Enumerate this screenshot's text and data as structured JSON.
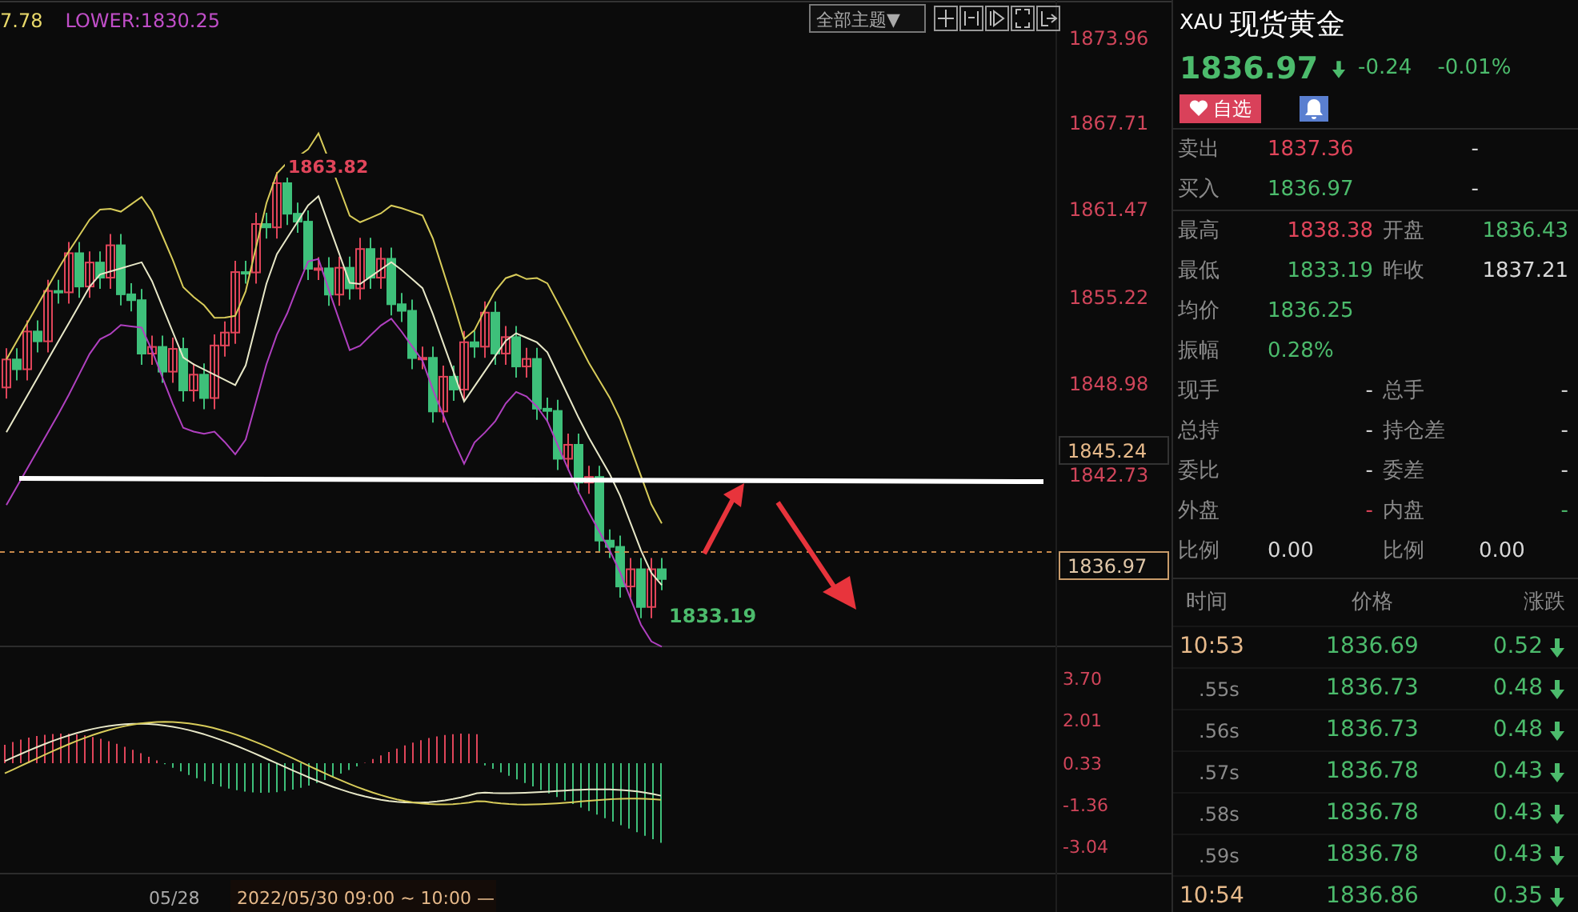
{
  "chart": {
    "indicators": [
      {
        "text": "7.78",
        "color": "#e8d86a"
      },
      {
        "text": "LOWER:1830.25",
        "color": "#c04ec8"
      }
    ],
    "theme_dropdown": "全部主题▼",
    "toolbar_buttons": [
      {
        "kind": "crosshair"
      },
      {
        "kind": "zoom-in"
      },
      {
        "kind": "play"
      },
      {
        "kind": "fullscreen"
      },
      {
        "kind": "exit"
      }
    ],
    "price_axis": [
      "1873.96",
      "1867.71",
      "1861.47",
      "1855.22",
      "1848.98",
      "1842.73"
    ],
    "price_tags": [
      {
        "text": "1845.24",
        "kind": "level"
      },
      {
        "text": "1836.97",
        "kind": "current"
      }
    ],
    "high_label": "1863.82",
    "low_label": "1833.19",
    "macd_axis": [
      "3.70",
      "2.01",
      "0.33",
      "-1.36",
      "-3.04"
    ],
    "time_axis": [
      {
        "text": "05/28",
        "kind": "date"
      },
      {
        "text": "2022/05/30 09:00 ~ 10:00 —",
        "kind": "cursor"
      }
    ]
  },
  "quote": {
    "symbol": "XAU",
    "name": "现货黄金",
    "price": "1836.97",
    "falling": true,
    "change": "-0.24",
    "change_pct": "-0.01%",
    "watch_button": "自选",
    "alert_button": {
      "kind": "bell"
    }
  },
  "order_rows": [
    {
      "label": "卖出",
      "value": "1837.36",
      "color": "#e0455a",
      "extra": "-"
    },
    {
      "label": "买入",
      "value": "1836.97",
      "color": "#4cbb6c",
      "extra": "-"
    }
  ],
  "stats": [
    {
      "cells": [
        {
          "label": "最高",
          "value": "1838.38",
          "color": "#e0455a"
        },
        {
          "label": "开盘",
          "value": "1836.43",
          "color": "#4cbb6c"
        }
      ]
    },
    {
      "cells": [
        {
          "label": "最低",
          "value": "1833.19",
          "color": "#4cbb6c"
        },
        {
          "label": "昨收",
          "value": "1837.21",
          "color": "#d8d8d8"
        }
      ]
    },
    {
      "cells": [
        {
          "label": "均价",
          "value": "1836.25",
          "color": "#4cbb6c"
        }
      ]
    },
    {
      "cells": [
        {
          "label": "振幅",
          "value": "0.28%",
          "color": "#4cbb6c"
        }
      ]
    },
    {
      "cells": [
        {
          "label": "现手",
          "value": "-",
          "color": "#d8d8d8"
        },
        {
          "label": "总手",
          "value": "-",
          "color": "#d8d8d8"
        }
      ]
    },
    {
      "cells": [
        {
          "label": "总持",
          "value": "-",
          "color": "#d8d8d8"
        },
        {
          "label": "持仓差",
          "value": "-",
          "color": "#d8d8d8"
        }
      ]
    },
    {
      "cells": [
        {
          "label": "委比",
          "value": "-",
          "color": "#d8d8d8"
        },
        {
          "label": "委差",
          "value": "-",
          "color": "#d8d8d8"
        }
      ]
    },
    {
      "cells": [
        {
          "label": "外盘",
          "value": "-",
          "color": "#e0455a"
        },
        {
          "label": "内盘",
          "value": "-",
          "color": "#4cbb6c"
        }
      ]
    },
    {
      "cells": [
        {
          "label": "比例",
          "value": "0.00",
          "color": "#d8d8d8"
        },
        {
          "label": "比例",
          "value": "0.00",
          "color": "#d8d8d8"
        }
      ]
    }
  ],
  "ticks_header": [
    "时间",
    "价格",
    "涨跌"
  ],
  "ticks": [
    {
      "time": "10:53",
      "kind": "minute",
      "price": "1836.69",
      "change": "0.52",
      "falling": true
    },
    {
      "time": ".55s",
      "kind": "second",
      "price": "1836.73",
      "change": "0.48",
      "falling": true
    },
    {
      "time": ".56s",
      "kind": "second",
      "price": "1836.73",
      "change": "0.48",
      "falling": true
    },
    {
      "time": ".57s",
      "kind": "second",
      "price": "1836.78",
      "change": "0.43",
      "falling": true
    },
    {
      "time": ".58s",
      "kind": "second",
      "price": "1836.78",
      "change": "0.43",
      "falling": true
    },
    {
      "time": ".59s",
      "kind": "second",
      "price": "1836.78",
      "change": "0.43",
      "falling": true
    },
    {
      "time": "10:54",
      "kind": "minute",
      "price": "1836.86",
      "change": "0.35",
      "falling": true
    }
  ]
}
